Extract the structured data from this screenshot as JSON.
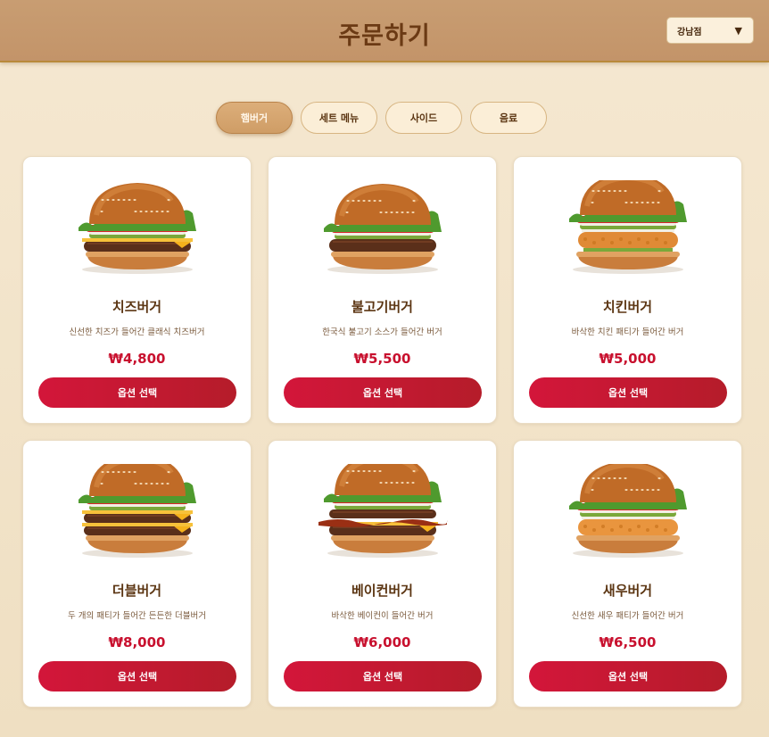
{
  "header": {
    "title": "주문하기",
    "store": {
      "selected": "강남점",
      "icon": "caret-down-icon"
    }
  },
  "tabs": [
    {
      "label": "햄버거",
      "active": true
    },
    {
      "label": "세트 메뉴",
      "active": false
    },
    {
      "label": "사이드",
      "active": false
    },
    {
      "label": "음료",
      "active": false
    }
  ],
  "menu": [
    {
      "name": "치즈버거",
      "description": "신선한 치즈가 들어간 클래식 치즈버거",
      "price": "₩4,800",
      "button": "옵션 선택",
      "image": "cheese-burger-image"
    },
    {
      "name": "불고기버거",
      "description": "한국식 불고기 소스가 들어간 버거",
      "price": "₩5,500",
      "button": "옵션 선택",
      "image": "bulgogi-burger-image"
    },
    {
      "name": "치킨버거",
      "description": "바삭한 치킨 패티가 들어간 버거",
      "price": "₩5,000",
      "button": "옵션 선택",
      "image": "chicken-burger-image"
    },
    {
      "name": "더블버거",
      "description": "두 개의 패티가 들어간 든든한 더블버거",
      "price": "₩8,000",
      "button": "옵션 선택",
      "image": "double-burger-image"
    },
    {
      "name": "베이컨버거",
      "description": "바삭한 베이컨이 들어간 버거",
      "price": "₩6,000",
      "button": "옵션 선택",
      "image": "bacon-burger-image"
    },
    {
      "name": "새우버거",
      "description": "신선한 새우 패티가 들어간 버거",
      "price": "₩6,500",
      "button": "옵션 선택",
      "image": "shrimp-burger-image"
    }
  ],
  "colors": {
    "accent": "#c8102e",
    "header": "#c89d72",
    "title": "#6b3a14",
    "background": "#f5e8d1"
  }
}
